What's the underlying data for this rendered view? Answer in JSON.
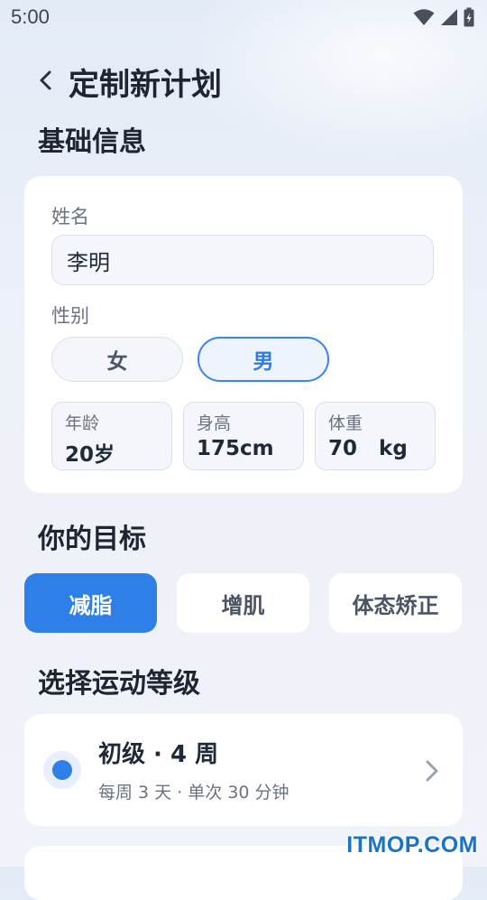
{
  "status_bar": {
    "time": "5:00",
    "icons": [
      "wifi-icon",
      "signal-icon",
      "battery-icon"
    ]
  },
  "header": {
    "title": "定制新计划",
    "back_icon": "chevron-left-icon"
  },
  "basic_info": {
    "title": "基础信息",
    "name_label": "姓名",
    "name_value": "李明",
    "gender_label": "性别",
    "gender_options": [
      "女",
      "男"
    ],
    "gender_selected": "男",
    "metrics": [
      {
        "label": "年龄",
        "value": "20岁"
      },
      {
        "label": "身高",
        "value": "175cm"
      },
      {
        "label": "体重",
        "value": "70   kg"
      }
    ]
  },
  "goal": {
    "title": "你的目标",
    "options": [
      "减脂",
      "增肌",
      "体态矫正"
    ],
    "selected": "减脂"
  },
  "level": {
    "title": "选择运动等级",
    "items": [
      {
        "title": "初级 · 4 周",
        "subtitle": "每周 3 天 · 单次 30 分钟",
        "selected": true
      }
    ]
  },
  "watermark": "ITMOP.COM",
  "colors": {
    "accent": "#2f7fe8",
    "background": "#edf1f8",
    "card": "#ffffff"
  }
}
